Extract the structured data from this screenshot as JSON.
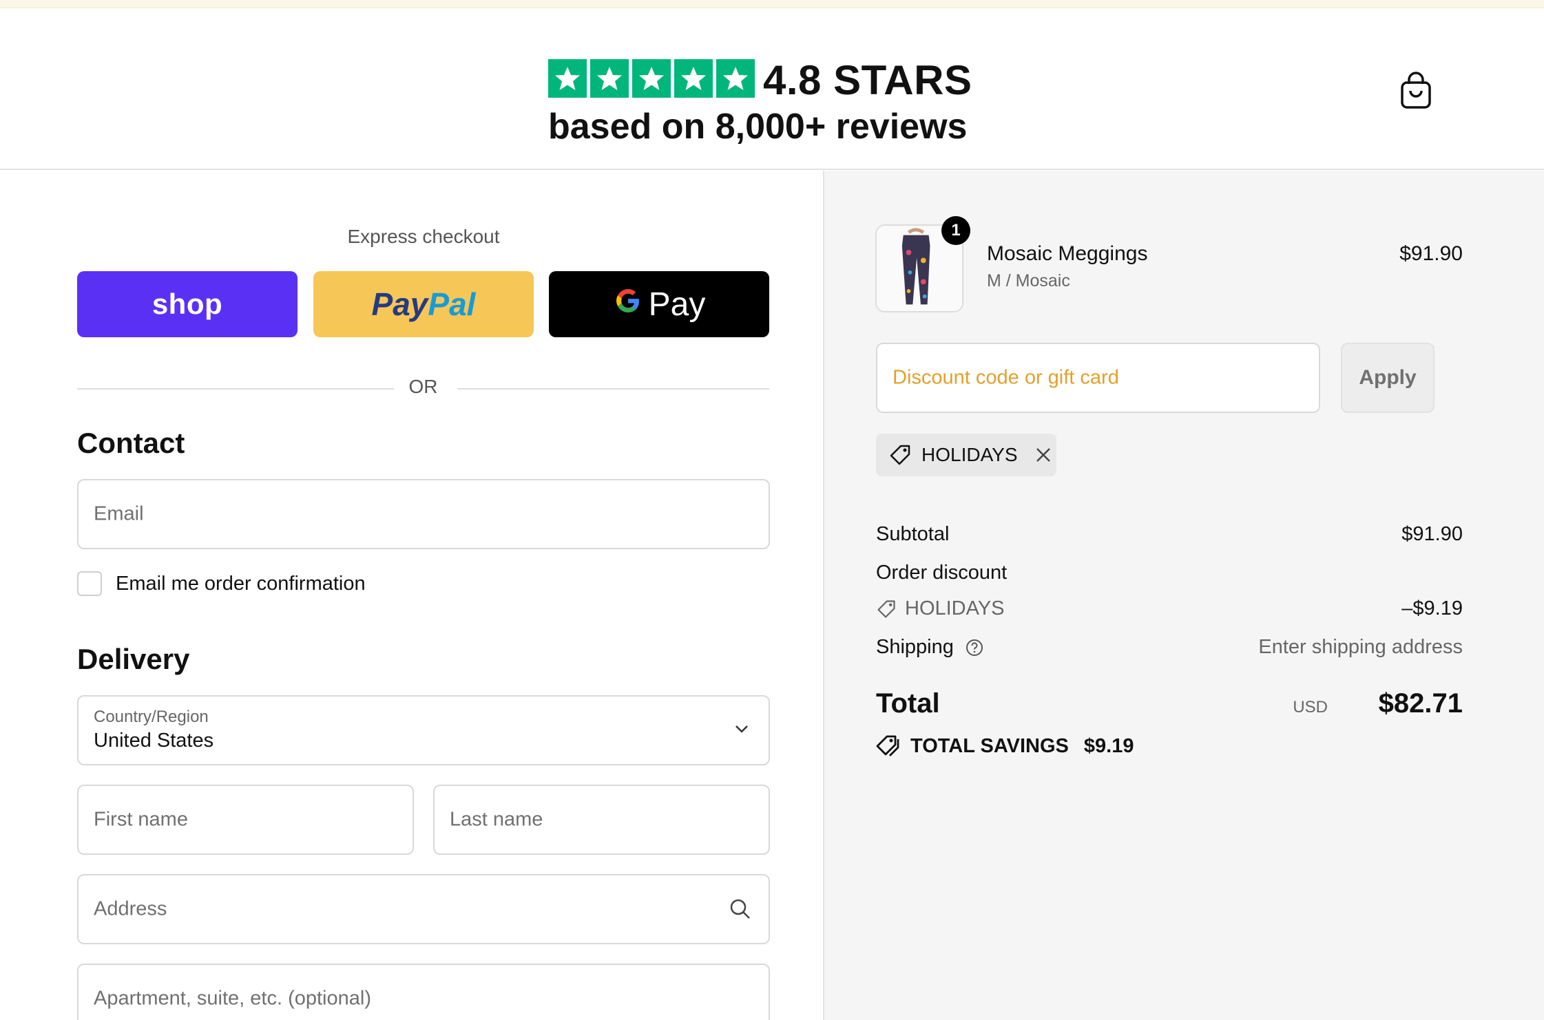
{
  "header": {
    "rating_text": "4.8 STARS",
    "rating_value": 4.8,
    "star_count": 5,
    "star_color": "#00b67a",
    "reviews_text": "based on 8,000+ reviews",
    "cart_icon": "shopping-bag-icon"
  },
  "express": {
    "title": "Express checkout",
    "shop_label": "shop",
    "paypal_label_1": "Pay",
    "paypal_label_2": "Pal",
    "gpay_g": "G",
    "gpay_label": "Pay",
    "or_label": "OR",
    "colors": {
      "shop": "#5a31f4",
      "paypal": "#f6c657",
      "gpay": "#000000"
    }
  },
  "contact": {
    "heading": "Contact",
    "email_placeholder": "Email",
    "email_optin_label": "Email me order confirmation",
    "email_optin_checked": false
  },
  "delivery": {
    "heading": "Delivery",
    "country_label": "Country/Region",
    "country_value": "United States",
    "first_name_placeholder": "First name",
    "last_name_placeholder": "Last name",
    "address_placeholder": "Address",
    "apartment_placeholder": "Apartment, suite, etc. (optional)"
  },
  "order": {
    "item": {
      "quantity": "1",
      "name": "Mosaic Meggings",
      "variant": "M / Mosaic",
      "price": "$91.90"
    },
    "discount_placeholder": "Discount code or gift card",
    "apply_label": "Apply",
    "applied_code": "HOLIDAYS",
    "subtotal_label": "Subtotal",
    "subtotal_value": "$91.90",
    "order_discount_label": "Order discount",
    "discount_code": "HOLIDAYS",
    "discount_value": "–$9.19",
    "shipping_label": "Shipping",
    "shipping_value": "Enter shipping address",
    "total_label": "Total",
    "total_currency": "USD",
    "total_value": "$82.71",
    "savings_label": "TOTAL SAVINGS",
    "savings_value": "$9.19"
  }
}
